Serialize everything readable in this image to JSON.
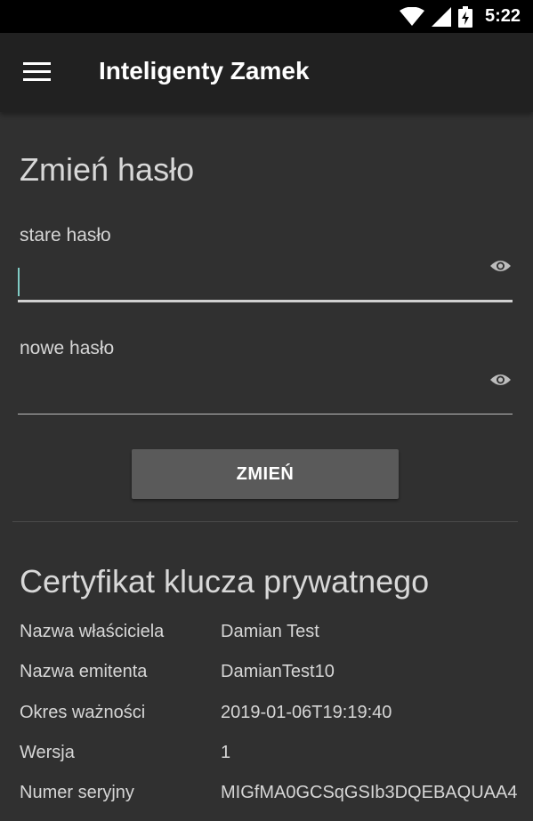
{
  "status_bar": {
    "time": "5:22",
    "icons": [
      "wifi-icon",
      "cell-signal-icon",
      "battery-charging-icon"
    ]
  },
  "app_bar": {
    "title": "Inteligenty Zamek",
    "menu_icon": "hamburger-menu-icon"
  },
  "change_password": {
    "title": "Zmień hasło",
    "old_password_label": "stare hasło",
    "old_password_value": "",
    "new_password_label": "nowe hasło",
    "new_password_value": "",
    "toggle_icon": "eye-icon",
    "submit_label": "ZMIEŃ"
  },
  "certificate": {
    "title": "Certyfikat klucza prywatnego",
    "rows": [
      {
        "key": "Nazwa właściciela",
        "value": "Damian Test"
      },
      {
        "key": "Nazwa emitenta",
        "value": "DamianTest10"
      },
      {
        "key": "Okres ważności",
        "value": "2019-01-06T19:19:40"
      },
      {
        "key": "Wersja",
        "value": "1"
      },
      {
        "key": "Numer seryjny",
        "value": "MIGfMA0GCSqGSIb3DQEBAQUAA4"
      }
    ]
  },
  "colors": {
    "background": "#303030",
    "app_bar": "#212121",
    "status_bar": "#000000",
    "accent_cursor": "#80cbc4",
    "button": "#5a5a5a"
  }
}
